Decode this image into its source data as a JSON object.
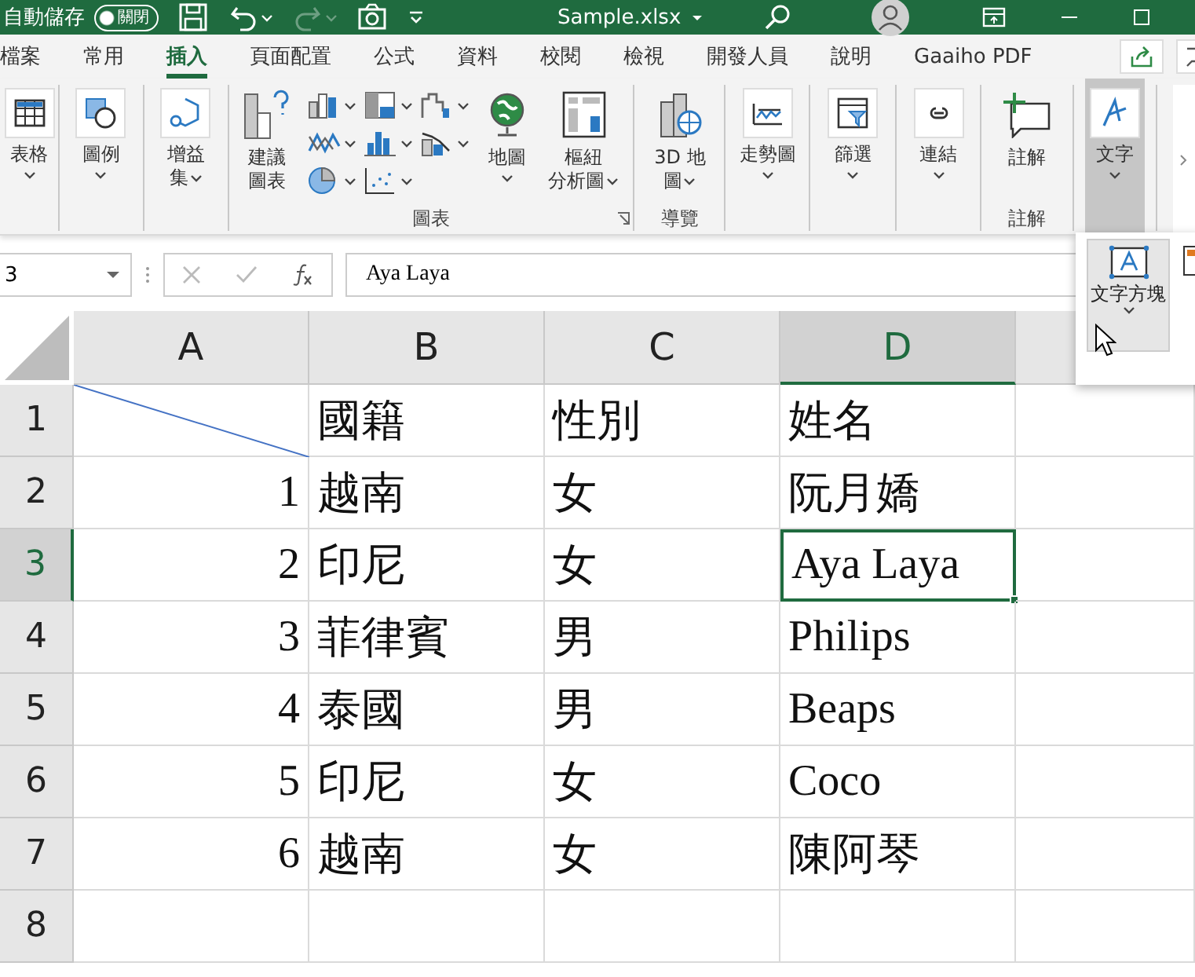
{
  "title_bar": {
    "autosave_label": "自動儲存",
    "autosave_toggle": {
      "label": "關閉",
      "on": false
    },
    "quick_access": [
      {
        "disabled": false
      },
      {
        "disabled": false
      },
      {
        "disabled": true
      },
      {
        "disabled": false
      },
      {
        "disabled": false
      }
    ],
    "file_name": "Sample.xlsx"
  },
  "tabs": [
    {
      "label": "檔案",
      "selected": false
    },
    {
      "label": "常用",
      "selected": false
    },
    {
      "label": "插入",
      "selected": true
    },
    {
      "label": "頁面配置",
      "selected": false
    },
    {
      "label": "公式",
      "selected": false
    },
    {
      "label": "資料",
      "selected": false
    },
    {
      "label": "校閱",
      "selected": false
    },
    {
      "label": "檢視",
      "selected": false
    },
    {
      "label": "開發人員",
      "selected": false
    },
    {
      "label": "說明",
      "selected": false
    },
    {
      "label": "Gaaiho PDF",
      "selected": false
    }
  ],
  "ribbon": {
    "groups": [
      {
        "buttons": [
          {
            "kind": "large",
            "label": "表格",
            "selected": false
          }
        ]
      },
      {
        "buttons": [
          {
            "kind": "large",
            "label": "圖例",
            "selected": false
          }
        ]
      },
      {
        "buttons": [
          {
            "kind": "large",
            "label": "增益集",
            "selected": false
          }
        ]
      },
      {
        "label": "圖表",
        "launcher": true,
        "buttons": [
          {
            "kind": "large",
            "label": "建議圖表",
            "selected": false
          },
          {
            "kind": "gallery"
          },
          {
            "kind": "large",
            "label": "地圖",
            "selected": false
          },
          {
            "kind": "large",
            "label": "樞紐分析圖",
            "selected": false
          }
        ]
      },
      {
        "label": "導覽",
        "buttons": [
          {
            "kind": "large",
            "label": "3D 地圖",
            "selected": false
          }
        ]
      },
      {
        "buttons": [
          {
            "kind": "large",
            "label": "走勢圖",
            "selected": false
          }
        ]
      },
      {
        "buttons": [
          {
            "kind": "large",
            "label": "篩選",
            "selected": false
          }
        ]
      },
      {
        "buttons": [
          {
            "kind": "large",
            "label": "連結",
            "selected": false
          }
        ]
      },
      {
        "label": "註解",
        "buttons": [
          {
            "kind": "large",
            "label": "註解",
            "selected": false
          }
        ]
      },
      {
        "buttons": [
          {
            "kind": "large",
            "label": "文字",
            "selected": true
          }
        ]
      }
    ]
  },
  "formula_bar": {
    "name_box": "3",
    "formula": "Aya Laya"
  },
  "popup": {
    "items": [
      {
        "label": "文字方塊",
        "selected": true
      },
      {
        "selected": false
      }
    ]
  },
  "sheet": {
    "columns": [
      {
        "label": "A",
        "selected": false
      },
      {
        "label": "B",
        "selected": false
      },
      {
        "label": "C",
        "selected": false
      },
      {
        "label": "D",
        "selected": true
      }
    ],
    "rows": [
      {
        "header": "1",
        "selected": false,
        "cells": [
          {
            "diagonal": true,
            "selected": false
          },
          {
            "text": "國籍",
            "selected": false
          },
          {
            "text": "性別",
            "selected": false
          },
          {
            "text": "姓名",
            "selected": false
          }
        ]
      },
      {
        "header": "2",
        "selected": false,
        "cells": [
          {
            "text": "1",
            "selected": false
          },
          {
            "text": "越南",
            "selected": false
          },
          {
            "text": "女",
            "selected": false
          },
          {
            "text": "阮月嬌",
            "selected": false
          }
        ]
      },
      {
        "header": "3",
        "selected": true,
        "cells": [
          {
            "text": "2",
            "selected": false
          },
          {
            "text": "印尼",
            "selected": false
          },
          {
            "text": "女",
            "selected": false
          },
          {
            "text": "Aya Laya",
            "selected": true
          }
        ]
      },
      {
        "header": "4",
        "selected": false,
        "cells": [
          {
            "text": "3",
            "selected": false
          },
          {
            "text": "菲律賓",
            "selected": false
          },
          {
            "text": "男",
            "selected": false
          },
          {
            "text": "Philips",
            "selected": false
          }
        ]
      },
      {
        "header": "5",
        "selected": false,
        "cells": [
          {
            "text": "4",
            "selected": false
          },
          {
            "text": "泰國",
            "selected": false
          },
          {
            "text": "男",
            "selected": false
          },
          {
            "text": "Beaps",
            "selected": false
          }
        ]
      },
      {
        "header": "6",
        "selected": false,
        "cells": [
          {
            "text": "5",
            "selected": false
          },
          {
            "text": "印尼",
            "selected": false
          },
          {
            "text": "女",
            "selected": false
          },
          {
            "text": "Coco",
            "selected": false
          }
        ]
      },
      {
        "header": "7",
        "selected": false,
        "cells": [
          {
            "text": "6",
            "selected": false
          },
          {
            "text": "越南",
            "selected": false
          },
          {
            "text": "女",
            "selected": false
          },
          {
            "text": "陳阿琴",
            "selected": false
          }
        ]
      },
      {
        "header": "8",
        "selected": false,
        "cells": []
      }
    ]
  }
}
